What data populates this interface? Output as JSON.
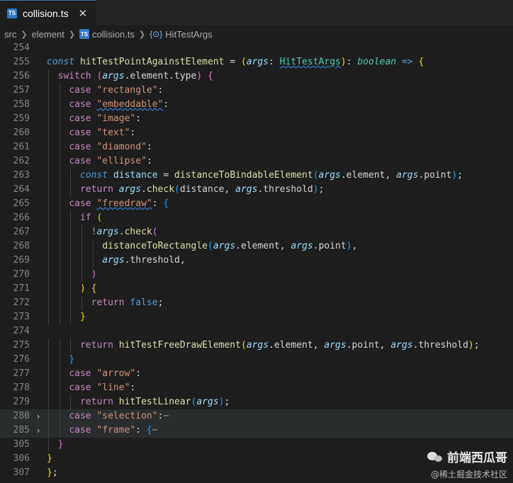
{
  "tab": {
    "badge": "TS",
    "label": "collision.ts",
    "close": "✕"
  },
  "breadcrumb": {
    "items": [
      "src",
      "element",
      "collision.ts",
      "HitTestArgs"
    ],
    "file_badge": "TS",
    "symbol_icon": "{⊙}"
  },
  "editor": {
    "lines": [
      {
        "num": "254",
        "fold": "",
        "tokens": []
      },
      {
        "num": "255",
        "fold": "",
        "tokens": [
          {
            "t": "const ",
            "c": "kw-i"
          },
          {
            "t": "hitTestPointAgainstElement",
            "c": "fn"
          },
          {
            "t": " = ",
            "c": "p"
          },
          {
            "t": "(",
            "c": "b1"
          },
          {
            "t": "args",
            "c": "param"
          },
          {
            "t": ": ",
            "c": "p"
          },
          {
            "t": "HitTestArgs",
            "c": "type-u"
          },
          {
            "t": ")",
            "c": "b1"
          },
          {
            "t": ": ",
            "c": "p"
          },
          {
            "t": "boolean",
            "c": "type-i"
          },
          {
            "t": " => ",
            "c": "kw"
          },
          {
            "t": "{",
            "c": "b1"
          }
        ]
      },
      {
        "num": "256",
        "fold": "",
        "tokens": [
          {
            "t": "switch ",
            "c": "ctrl"
          },
          {
            "t": "(",
            "c": "b2"
          },
          {
            "t": "args",
            "c": "param"
          },
          {
            "t": ".element.type",
            "c": "p"
          },
          {
            "t": ")",
            "c": "b2"
          },
          {
            "t": " {",
            "c": "b2"
          }
        ]
      },
      {
        "num": "257",
        "fold": "",
        "tokens": [
          {
            "t": "case ",
            "c": "ctrl"
          },
          {
            "t": "\"rectangle\"",
            "c": "str"
          },
          {
            "t": ":",
            "c": "p"
          }
        ]
      },
      {
        "num": "258",
        "fold": "",
        "tokens": [
          {
            "t": "case ",
            "c": "ctrl"
          },
          {
            "t": "\"embeddable\"",
            "c": "str-u"
          },
          {
            "t": ":",
            "c": "p"
          }
        ]
      },
      {
        "num": "259",
        "fold": "",
        "tokens": [
          {
            "t": "case ",
            "c": "ctrl"
          },
          {
            "t": "\"image\"",
            "c": "str"
          },
          {
            "t": ":",
            "c": "p"
          }
        ]
      },
      {
        "num": "260",
        "fold": "",
        "tokens": [
          {
            "t": "case ",
            "c": "ctrl"
          },
          {
            "t": "\"text\"",
            "c": "str"
          },
          {
            "t": ":",
            "c": "p"
          }
        ]
      },
      {
        "num": "261",
        "fold": "",
        "tokens": [
          {
            "t": "case ",
            "c": "ctrl"
          },
          {
            "t": "\"diamond\"",
            "c": "str"
          },
          {
            "t": ":",
            "c": "p"
          }
        ]
      },
      {
        "num": "262",
        "fold": "",
        "tokens": [
          {
            "t": "case ",
            "c": "ctrl"
          },
          {
            "t": "\"ellipse\"",
            "c": "str"
          },
          {
            "t": ":",
            "c": "p"
          }
        ]
      },
      {
        "num": "263",
        "fold": "",
        "tokens": [
          {
            "t": "const ",
            "c": "kw-i"
          },
          {
            "t": "distance",
            "c": "var"
          },
          {
            "t": " = ",
            "c": "p"
          },
          {
            "t": "distanceToBindableElement",
            "c": "fn"
          },
          {
            "t": "(",
            "c": "b3"
          },
          {
            "t": "args",
            "c": "param"
          },
          {
            "t": ".element, ",
            "c": "p"
          },
          {
            "t": "args",
            "c": "param"
          },
          {
            "t": ".point",
            "c": "p"
          },
          {
            "t": ")",
            "c": "b3"
          },
          {
            "t": ";",
            "c": "p"
          }
        ]
      },
      {
        "num": "264",
        "fold": "",
        "tokens": [
          {
            "t": "return ",
            "c": "ctrl"
          },
          {
            "t": "args",
            "c": "param"
          },
          {
            "t": ".",
            "c": "p"
          },
          {
            "t": "check",
            "c": "fn"
          },
          {
            "t": "(",
            "c": "b3"
          },
          {
            "t": "distance, ",
            "c": "p"
          },
          {
            "t": "args",
            "c": "param"
          },
          {
            "t": ".threshold",
            "c": "p"
          },
          {
            "t": ")",
            "c": "b3"
          },
          {
            "t": ";",
            "c": "p"
          }
        ]
      },
      {
        "num": "265",
        "fold": "",
        "tokens": [
          {
            "t": "case ",
            "c": "ctrl"
          },
          {
            "t": "\"freedraw\"",
            "c": "str-u"
          },
          {
            "t": ": ",
            "c": "p"
          },
          {
            "t": "{",
            "c": "b3"
          }
        ]
      },
      {
        "num": "266",
        "fold": "",
        "tokens": [
          {
            "t": "if ",
            "c": "ctrl"
          },
          {
            "t": "(",
            "c": "b1"
          }
        ]
      },
      {
        "num": "267",
        "fold": "",
        "tokens": [
          {
            "t": "!",
            "c": "str"
          },
          {
            "t": "args",
            "c": "param"
          },
          {
            "t": ".",
            "c": "p"
          },
          {
            "t": "check",
            "c": "fn"
          },
          {
            "t": "(",
            "c": "b2"
          }
        ]
      },
      {
        "num": "268",
        "fold": "",
        "tokens": [
          {
            "t": "distanceToRectangle",
            "c": "fn"
          },
          {
            "t": "(",
            "c": "b3"
          },
          {
            "t": "args",
            "c": "param"
          },
          {
            "t": ".element, ",
            "c": "p"
          },
          {
            "t": "args",
            "c": "param"
          },
          {
            "t": ".point",
            "c": "p"
          },
          {
            "t": ")",
            "c": "b3"
          },
          {
            "t": ",",
            "c": "p"
          }
        ]
      },
      {
        "num": "269",
        "fold": "",
        "tokens": [
          {
            "t": "args",
            "c": "param"
          },
          {
            "t": ".threshold,",
            "c": "p"
          }
        ]
      },
      {
        "num": "270",
        "fold": "",
        "tokens": [
          {
            "t": ")",
            "c": "b2"
          }
        ]
      },
      {
        "num": "271",
        "fold": "",
        "tokens": [
          {
            "t": ")",
            "c": "b1"
          },
          {
            "t": " {",
            "c": "b1"
          }
        ]
      },
      {
        "num": "272",
        "fold": "",
        "tokens": [
          {
            "t": "return ",
            "c": "ctrl"
          },
          {
            "t": "false",
            "c": "kw"
          },
          {
            "t": ";",
            "c": "p"
          }
        ]
      },
      {
        "num": "273",
        "fold": "",
        "tokens": [
          {
            "t": "}",
            "c": "b1"
          }
        ]
      },
      {
        "num": "274",
        "fold": "",
        "tokens": []
      },
      {
        "num": "275",
        "fold": "",
        "tokens": [
          {
            "t": "return ",
            "c": "ctrl"
          },
          {
            "t": "hitTestFreeDrawElement",
            "c": "fn"
          },
          {
            "t": "(",
            "c": "b1"
          },
          {
            "t": "args",
            "c": "param"
          },
          {
            "t": ".element, ",
            "c": "p"
          },
          {
            "t": "args",
            "c": "param"
          },
          {
            "t": ".point, ",
            "c": "p"
          },
          {
            "t": "args",
            "c": "param"
          },
          {
            "t": ".threshold",
            "c": "p"
          },
          {
            "t": ")",
            "c": "b1"
          },
          {
            "t": ";",
            "c": "p"
          }
        ]
      },
      {
        "num": "276",
        "fold": "",
        "tokens": [
          {
            "t": "}",
            "c": "b3"
          }
        ]
      },
      {
        "num": "277",
        "fold": "",
        "tokens": [
          {
            "t": "case ",
            "c": "ctrl"
          },
          {
            "t": "\"arrow\"",
            "c": "str"
          },
          {
            "t": ":",
            "c": "p"
          }
        ]
      },
      {
        "num": "278",
        "fold": "",
        "tokens": [
          {
            "t": "case ",
            "c": "ctrl"
          },
          {
            "t": "\"line\"",
            "c": "str"
          },
          {
            "t": ":",
            "c": "p"
          }
        ]
      },
      {
        "num": "279",
        "fold": "",
        "tokens": [
          {
            "t": "return ",
            "c": "ctrl"
          },
          {
            "t": "hitTestLinear",
            "c": "fn"
          },
          {
            "t": "(",
            "c": "b3"
          },
          {
            "t": "args",
            "c": "param"
          },
          {
            "t": ")",
            "c": "b3"
          },
          {
            "t": ";",
            "c": "p"
          }
        ]
      },
      {
        "num": "280",
        "fold": "›",
        "tokens": [
          {
            "t": "case ",
            "c": "ctrl"
          },
          {
            "t": "\"selection\"",
            "c": "str"
          },
          {
            "t": ":",
            "c": "p"
          },
          {
            "t": "⋯",
            "c": "ell"
          }
        ]
      },
      {
        "num": "285",
        "fold": "›",
        "tokens": [
          {
            "t": "case ",
            "c": "ctrl"
          },
          {
            "t": "\"frame\"",
            "c": "str"
          },
          {
            "t": ": ",
            "c": "p"
          },
          {
            "t": "{",
            "c": "b3"
          },
          {
            "t": "⋯",
            "c": "ell"
          }
        ]
      },
      {
        "num": "305",
        "fold": "",
        "tokens": [
          {
            "t": "}",
            "c": "b2"
          }
        ]
      },
      {
        "num": "306",
        "fold": "",
        "tokens": [
          {
            "t": "}",
            "c": "b1"
          }
        ]
      },
      {
        "num": "307",
        "fold": "",
        "tokens": [
          {
            "t": "}",
            "c": "b1"
          },
          {
            "t": ";",
            "c": "p"
          }
        ]
      }
    ]
  },
  "watermark": {
    "title": "前端西瓜哥",
    "subtitle": "@稀土掘金技术社区"
  },
  "colors": {
    "background": "#1e1e1e",
    "tab_bar": "#252526",
    "fold_highlight": "#2a2d2e",
    "ts_badge": "#3178c6"
  }
}
